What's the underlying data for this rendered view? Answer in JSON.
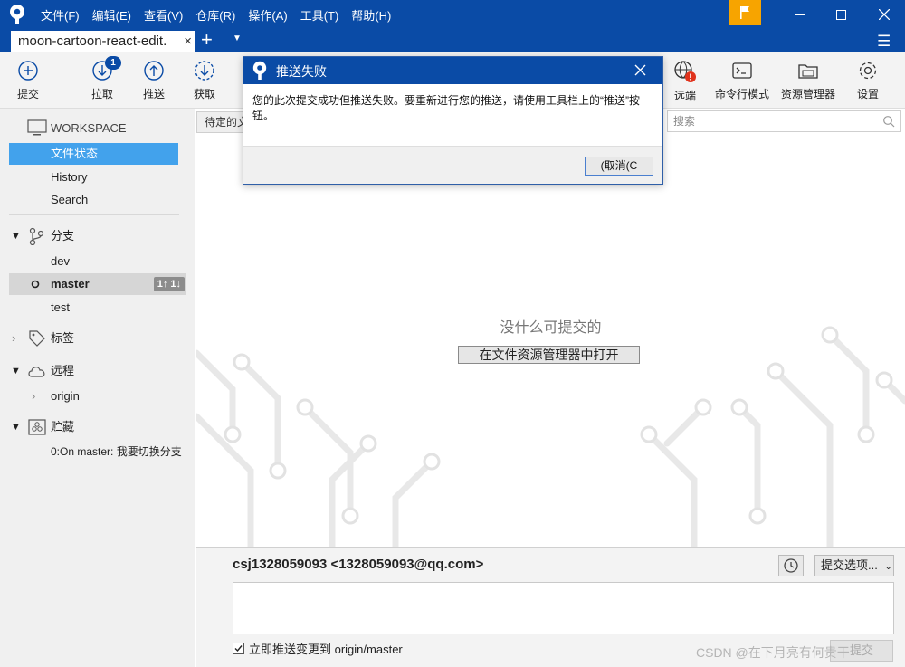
{
  "window": {
    "menu": [
      "文件(F)",
      "编辑(E)",
      "查看(V)",
      "仓库(R)",
      "操作(A)",
      "工具(T)",
      "帮助(H)"
    ]
  },
  "tabs": {
    "active": "moon-cartoon-react-edit.",
    "close": "×",
    "add": "+"
  },
  "toolbar": {
    "commit": "提交",
    "pull": "拉取",
    "pull_badge": "1",
    "push": "推送",
    "fetch": "获取",
    "remote": "远端",
    "terminal": "命令行模式",
    "explorer": "资源管理器",
    "settings": "设置"
  },
  "sidebar": {
    "workspace": "WORKSPACE",
    "file_status": "文件状态",
    "history": "History",
    "search": "Search",
    "branches_label": "分支",
    "branches": [
      "dev",
      "master",
      "test"
    ],
    "master_counts": "1↑ 1↓",
    "tags_label": "标签",
    "remotes_label": "远程",
    "remote_origin": "origin",
    "stashes_label": "贮藏",
    "stash_item": "0:On master: 我要切换分支"
  },
  "main": {
    "filter": "待定的文件",
    "search_placeholder": "搜索",
    "empty_message": "没什么可提交的",
    "open_in_explorer": "在文件资源管理器中打开"
  },
  "commit": {
    "author": "csj1328059093 <1328059093@qq.com>",
    "options": "提交选项...",
    "push_immediately": "立即推送变更到 origin/master",
    "commit_button": "提交"
  },
  "dialog": {
    "title": "推送失败",
    "message": "您的此次提交成功但推送失败。要重新进行您的推送，请使用工具栏上的“推送”按钮。",
    "cancel": "(取消(C"
  },
  "watermark": "CSDN @在下月亮有何贵干",
  "colors": {
    "brand_blue": "#0a4ba6",
    "selection_blue": "#42a2ec",
    "flag_orange": "#f7a400",
    "error_red": "#e0321c"
  }
}
